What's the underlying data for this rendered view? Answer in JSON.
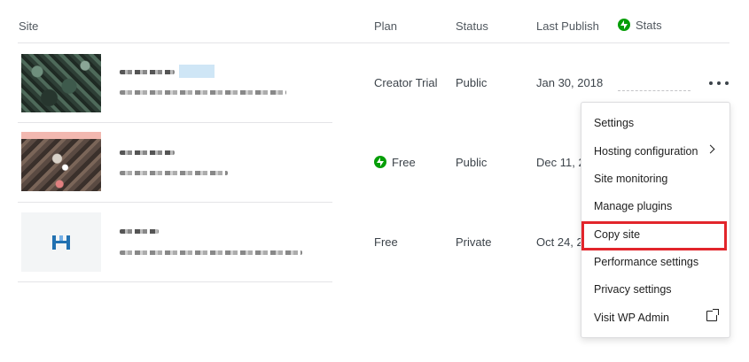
{
  "header": {
    "site": "Site",
    "plan": "Plan",
    "status": "Status",
    "last_publish": "Last Publish",
    "stats": "Stats"
  },
  "rows": [
    {
      "plan": "Creator Trial",
      "status": "Public",
      "last_publish": "Jan 30, 2018",
      "jetpack": false
    },
    {
      "plan": "Free",
      "status": "Public",
      "last_publish": "Dec 11, 2",
      "jetpack": true
    },
    {
      "plan": "Free",
      "status": "Private",
      "last_publish": "Oct 24, 2",
      "jetpack": false
    }
  ],
  "menu": {
    "items": [
      {
        "label": "Settings"
      },
      {
        "label": "Hosting configuration"
      },
      {
        "label": "Site monitoring"
      },
      {
        "label": "Manage plugins"
      },
      {
        "label": "Copy site"
      },
      {
        "label": "Performance settings"
      },
      {
        "label": "Privacy settings"
      },
      {
        "label": "Visit WP Admin"
      }
    ]
  },
  "colors": {
    "jetpack_green": "#069e08",
    "highlight": "#e2252b",
    "thumb_logo_blue": "#2271b1"
  },
  "icons": {
    "stats": "jetpack-bolt-icon",
    "more": "ellipsis-icon",
    "submenu": "chevron-right-icon",
    "external": "external-link-icon"
  }
}
